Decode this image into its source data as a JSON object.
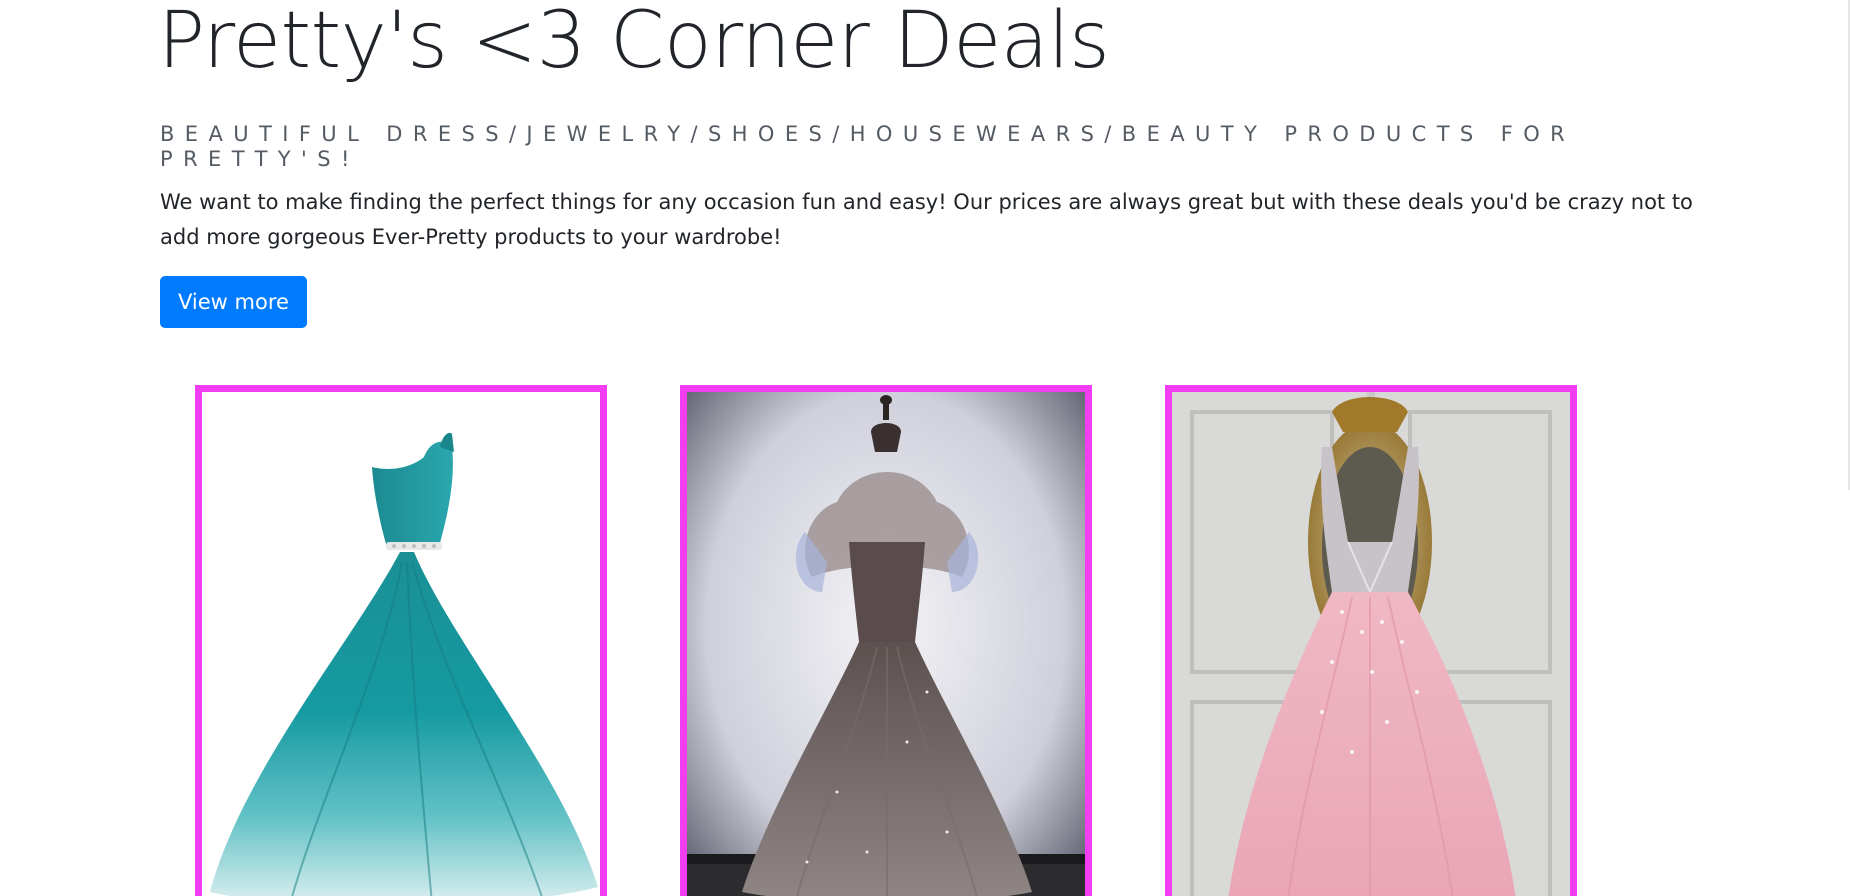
{
  "page": {
    "title": "Pretty's <3 Corner Deals",
    "tagline": "Beautiful Dress/Jewelry/Shoes/Housewears/Beauty Products for Pretty's!",
    "description": "We want to make finding the perfect things for any occasion fun and easy! Our prices are always great but with these deals you'd be crazy not to add more gorgeous Ever-Pretty products to your wardrobe!",
    "cta_label": "View more"
  },
  "colors": {
    "accent_button": "#007bff",
    "card_border": "#f23df2"
  },
  "products": [
    {
      "name": "teal-one-shoulder-gown-image"
    },
    {
      "name": "grey-tulle-gown-image"
    },
    {
      "name": "pink-beaded-gown-image"
    }
  ]
}
